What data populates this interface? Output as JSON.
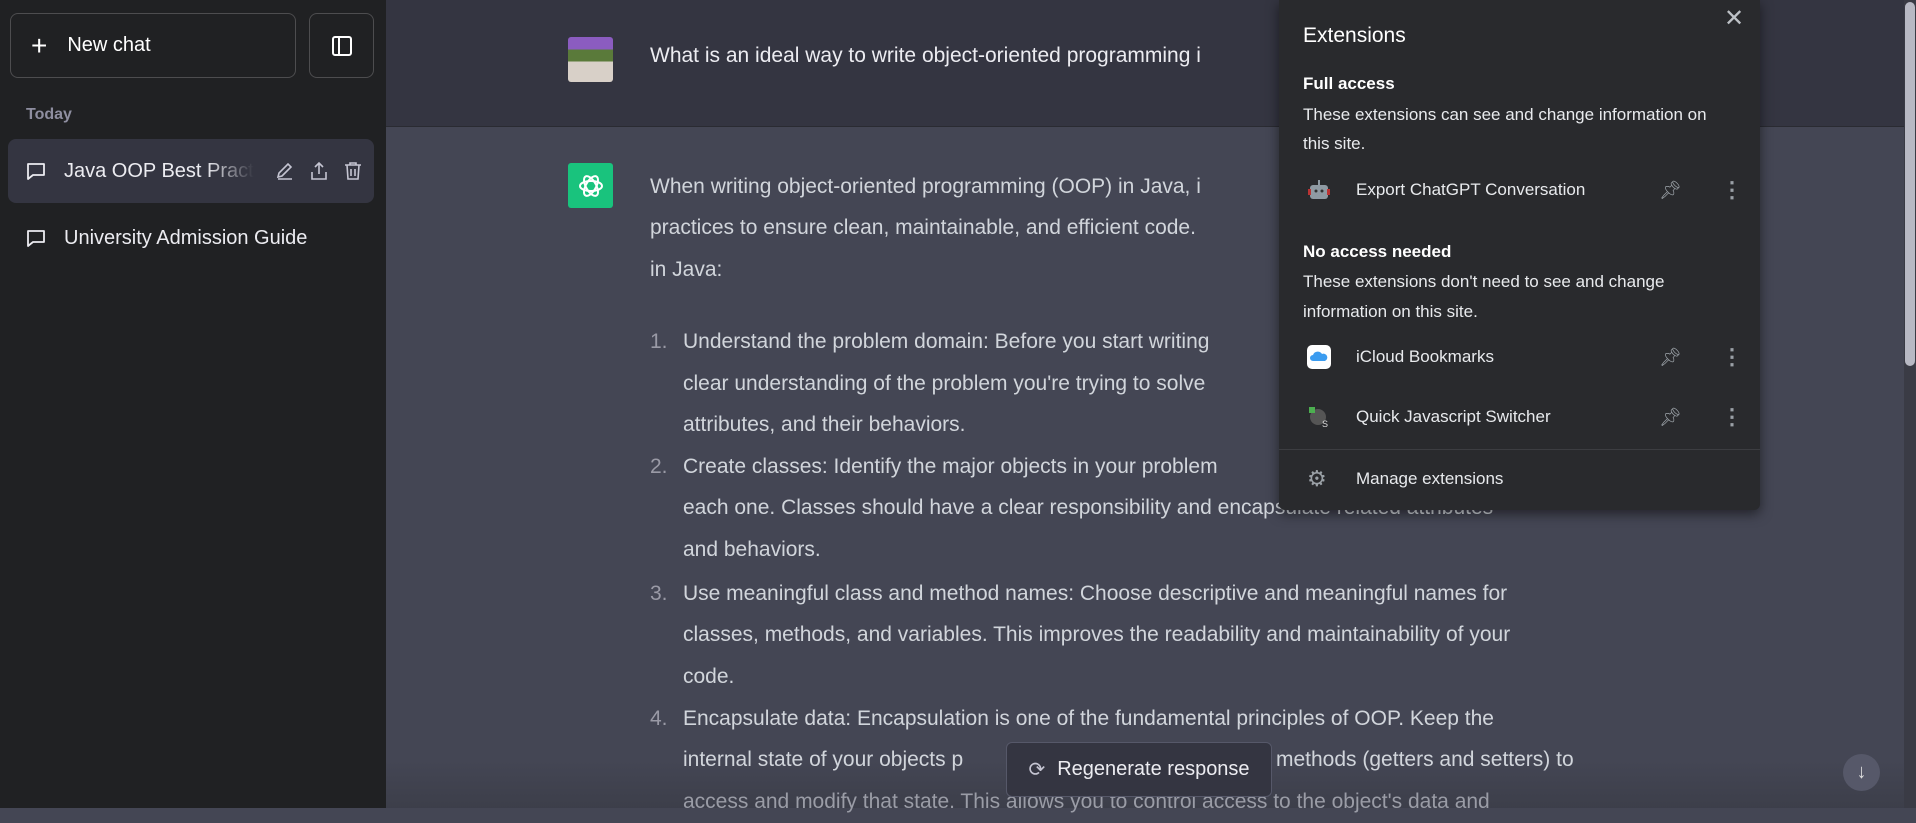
{
  "sidebar": {
    "new_chat": "New chat",
    "section": "Today",
    "chats": [
      {
        "label": "Java OOP Best Practi"
      },
      {
        "label": "University Admission Guide"
      }
    ]
  },
  "conversation": {
    "user_message": "What is an ideal way to write object-oriented programming i",
    "intro": [
      "When writing object-oriented programming (OOP) in Java, i",
      "practices to ensure clean, maintainable, and efficient code.",
      "in Java:"
    ],
    "list": [
      {
        "num": "1.",
        "lines": [
          "Understand the problem domain: Before you start writing",
          "clear understanding of the problem you're trying to solve",
          "attributes, and their behaviors."
        ]
      },
      {
        "num": "2.",
        "lines": [
          "Create classes: Identify the major objects in your problem",
          "each one. Classes should have a clear responsibility and encapsulate related attributes",
          "and behaviors."
        ]
      },
      {
        "num": "3.",
        "lines": [
          "Use meaningful class and method names: Choose descriptive and meaningful names for",
          "classes, methods, and variables. This improves the readability and maintainability of your",
          "code."
        ]
      },
      {
        "num": "4.",
        "lines": [
          "Encapsulate data: Encapsulation is one of the fundamental principles of OOP. Keep the",
          "internal state of your objects p",
          "methods (getters and setters) to",
          "access and modify that state. This allows you to control access to the object's data and"
        ]
      }
    ],
    "regenerate": "Regenerate response"
  },
  "extensions_popup": {
    "title": "Extensions",
    "full_access": {
      "heading": "Full access",
      "desc": [
        "These extensions can see and change information on",
        "this site."
      ],
      "items": [
        {
          "name": "Export ChatGPT Conversation",
          "icon": "robot-icon"
        }
      ]
    },
    "no_access": {
      "heading": "No access needed",
      "desc": [
        "These extensions don't need to see and change",
        "information on this site."
      ],
      "items": [
        {
          "name": "iCloud Bookmarks",
          "icon": "icloud-icon"
        },
        {
          "name": "Quick Javascript Switcher",
          "icon": "js-switcher-icon"
        }
      ]
    },
    "manage": "Manage extensions"
  },
  "colors": {
    "sidebar": "#202123",
    "user_bg": "#343541",
    "assistant_bg": "#444654",
    "popup_bg": "#292a2d",
    "accent": "#19c37d"
  }
}
